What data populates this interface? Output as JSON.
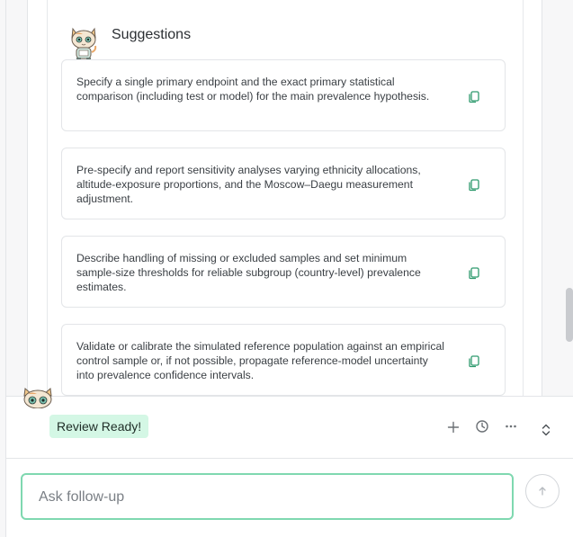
{
  "suggestions": {
    "title": "Suggestions",
    "items": [
      {
        "text": "Specify a single primary endpoint and the exact primary statistical comparison (including test or model) for the main prevalence hypothesis.",
        "action_icon": "copy-icon"
      },
      {
        "text": "Pre-specify and report sensitivity analyses varying ethnicity allocations, altitude-exposure proportions, and the Moscow–Daegu measurement adjustment.",
        "action_icon": "copy-icon"
      },
      {
        "text": "Describe handling of missing or excluded samples and set minimum sample-size thresholds for reliable subgroup (country-level) prevalence estimates.",
        "action_icon": "copy-icon"
      },
      {
        "text": "Validate or calibrate the simulated reference population against an empirical control sample or, if not possible, propagate reference-model uncertainty into prevalence confidence intervals.",
        "action_icon": "copy-icon"
      }
    ]
  },
  "chat": {
    "status": "Review Ready!",
    "toolbar_icons": [
      "plus-icon",
      "history-icon",
      "more-icon",
      "expand-collapse-icon"
    ],
    "input_placeholder": "Ask follow-up",
    "input_value": "",
    "send_icon": "arrow-up-icon"
  },
  "colors": {
    "accent_border": "#7fd8b0",
    "badge_bg": "#d4f7e5",
    "copy_icon": "#2f9a6e"
  }
}
